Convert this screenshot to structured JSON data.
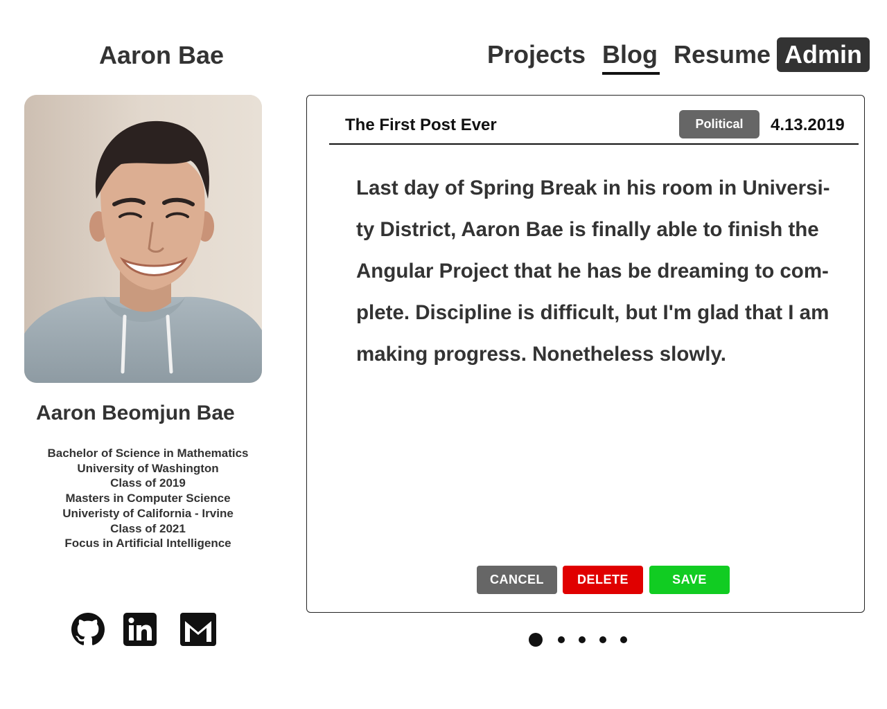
{
  "header": {
    "site_title": "Aaron Bae",
    "nav": [
      {
        "label": "Projects"
      },
      {
        "label": "Blog",
        "active": true
      },
      {
        "label": "Resume"
      },
      {
        "label": "Admin"
      }
    ]
  },
  "profile": {
    "photo_icon": "profile-photo",
    "name": "Aaron Beomjun Bae",
    "education": [
      "Bachelor of Science in Mathematics",
      "University of Washington",
      "Class of 2019",
      "Masters in Computer Science",
      "Univeristy of California - Irvine",
      "Class of 2021",
      "Focus in Artificial Intelligence"
    ],
    "socials": [
      {
        "icon": "github-icon"
      },
      {
        "icon": "linkedin-icon"
      },
      {
        "icon": "gmail-icon"
      }
    ]
  },
  "post": {
    "title": "The First Post Ever",
    "category": "Political",
    "date": "4.13.2019",
    "body_lines": [
      "Last day of Spring Break in his room in Universi-",
      "ty District, Aaron Bae is finally able to finish the",
      "Angular Project that he has be dreaming to com-",
      "plete. Discipline is difficult, but I'm glad that I am",
      "making progress. Nonetheless slowly."
    ],
    "buttons": {
      "cancel": "CANCEL",
      "delete": "DELETE",
      "save": "SAVE"
    }
  },
  "pagination": {
    "total_pages": 5,
    "current_page": 1
  },
  "colors": {
    "text": "#333333",
    "admin_bg": "#333333",
    "badge_bg": "#666666",
    "cancel": "#666666",
    "delete": "#e00000",
    "save": "#11cc22"
  }
}
